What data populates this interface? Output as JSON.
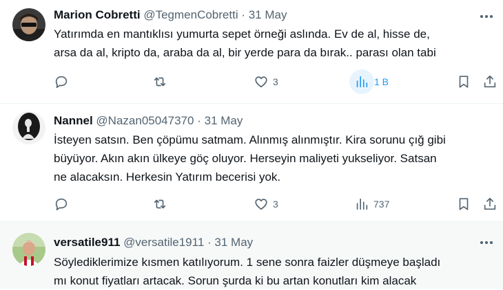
{
  "tweets": [
    {
      "name": "Marion Cobretti",
      "handle": "@TegmenCobretti",
      "dot": "·",
      "date": "31 May",
      "lines": [
        "Yatırımda en mantıklısı yumurta sepet örneği aslında. Ev de al, hisse de,",
        "arsa da al, kripto da, araba da al, bir yerde para da bırak.. parası olan tabi"
      ],
      "replies": "",
      "reposts": "",
      "likes": "3",
      "views": "1 B"
    },
    {
      "name": "Nannel",
      "handle": "@Nazan05047370",
      "dot": "·",
      "date": "31 May",
      "lines": [
        "İsteyen satsın. Ben çöpümu satmam. Alınmış alınmıştır. Kira sorunu çığ gibi",
        "büyüyor. Akın akın ülkeye göç oluyor. Herseyin maliyeti yukseliyor. Satsan",
        "ne alacaksın. Herkesin Yatırım becerisi yok."
      ],
      "replies": "",
      "reposts": "",
      "likes": "3",
      "views": "737"
    },
    {
      "name": "versatile911",
      "handle": "@versatile1911",
      "dot": "·",
      "date": "31 May",
      "lines": [
        "Söylediklerimize kısmen katılıyorum. 1 sene sonra faizler düşmeye başladı",
        "mı konut fiyatları artacak. Sorun şurda ki bu artan konutları kim alacak"
      ]
    }
  ],
  "colors": {
    "text": "#0f1419",
    "secondary": "#536471",
    "accent": "#1d9bf0",
    "divider": "#eff3f4"
  },
  "icons": [
    "reply-icon",
    "repost-icon",
    "like-icon",
    "views-icon",
    "bookmark-icon",
    "share-icon",
    "more-icon"
  ]
}
